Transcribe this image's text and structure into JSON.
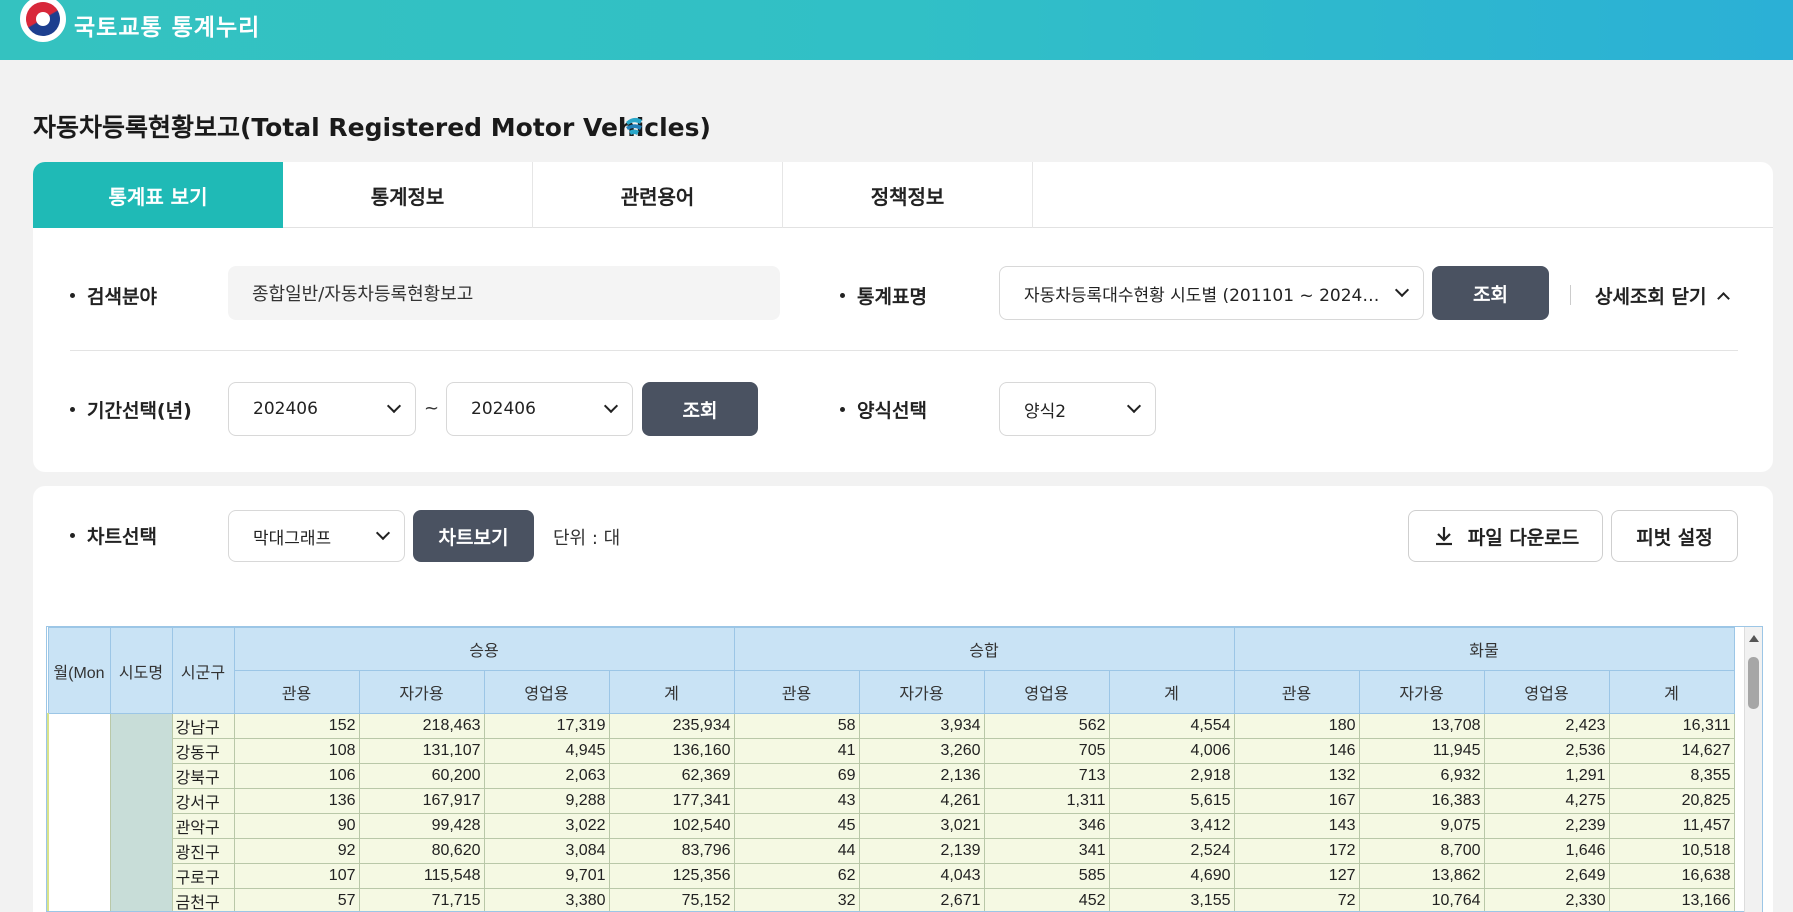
{
  "header": {
    "brand": "국토교통 통계누리"
  },
  "page": {
    "title": "자동차등록현황보고(Total Registered Motor Vehicles)"
  },
  "tabs": [
    {
      "label": "통계표 보기"
    },
    {
      "label": "통계정보"
    },
    {
      "label": "관련용어"
    },
    {
      "label": "정책정보"
    }
  ],
  "search": {
    "field_label": "검색분야",
    "field_value": "종합일반/자동차등록현황보고",
    "table_label": "통계표명",
    "table_value": "자동차등록대수현황 시도별 (201101 ~ 2024…",
    "query_button": "조회",
    "detail_toggle": "상세조회 닫기",
    "period_label": "기간선택(년)",
    "period_from": "202406",
    "period_sep": "~",
    "period_to": "202406",
    "period_button": "조회",
    "format_label": "양식선택",
    "format_value": "양식2"
  },
  "chart": {
    "label": "차트선택",
    "type_value": "막대그래프",
    "view_button": "차트보기",
    "unit": "단위 : 대",
    "download_button": "파일 다운로드",
    "pivot_button": "피벗 설정"
  },
  "table": {
    "fixed_headers": [
      "월(Mon",
      "시도명",
      "시군구"
    ],
    "groups": [
      "승용",
      "승합",
      "화물"
    ],
    "subheaders": [
      "관용",
      "자가용",
      "영업용",
      "계"
    ],
    "rows": [
      {
        "district": "강남구",
        "values": [
          "152",
          "218,463",
          "17,319",
          "235,934",
          "58",
          "3,934",
          "562",
          "4,554",
          "180",
          "13,708",
          "2,423",
          "16,311"
        ]
      },
      {
        "district": "강동구",
        "values": [
          "108",
          "131,107",
          "4,945",
          "136,160",
          "41",
          "3,260",
          "705",
          "4,006",
          "146",
          "11,945",
          "2,536",
          "14,627"
        ]
      },
      {
        "district": "강북구",
        "values": [
          "106",
          "60,200",
          "2,063",
          "62,369",
          "69",
          "2,136",
          "713",
          "2,918",
          "132",
          "6,932",
          "1,291",
          "8,355"
        ]
      },
      {
        "district": "강서구",
        "values": [
          "136",
          "167,917",
          "9,288",
          "177,341",
          "43",
          "4,261",
          "1,311",
          "5,615",
          "167",
          "16,383",
          "4,275",
          "20,825"
        ]
      },
      {
        "district": "관악구",
        "values": [
          "90",
          "99,428",
          "3,022",
          "102,540",
          "45",
          "3,021",
          "346",
          "3,412",
          "143",
          "9,075",
          "2,239",
          "11,457"
        ]
      },
      {
        "district": "광진구",
        "values": [
          "92",
          "80,620",
          "3,084",
          "83,796",
          "44",
          "2,139",
          "341",
          "2,524",
          "172",
          "8,700",
          "1,646",
          "10,518"
        ]
      },
      {
        "district": "구로구",
        "values": [
          "107",
          "115,548",
          "9,701",
          "125,356",
          "62",
          "4,043",
          "585",
          "4,690",
          "127",
          "13,862",
          "2,649",
          "16,638"
        ]
      },
      {
        "district": "금천구",
        "values": [
          "57",
          "71,715",
          "3,380",
          "75,152",
          "32",
          "2,671",
          "452",
          "3,155",
          "72",
          "10,764",
          "2,330",
          "13,166"
        ]
      }
    ]
  }
}
